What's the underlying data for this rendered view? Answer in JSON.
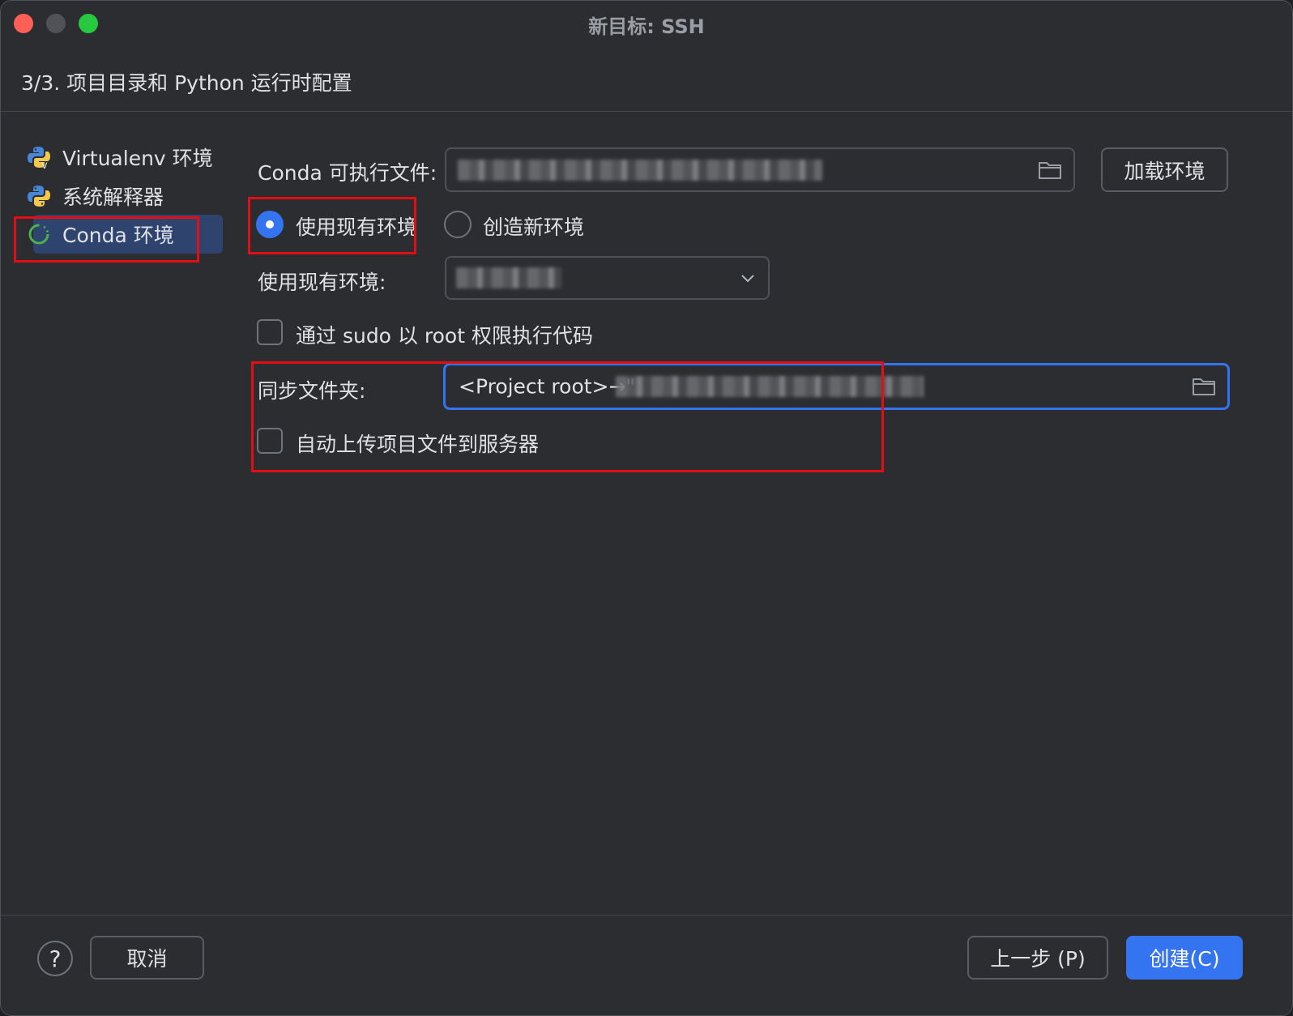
{
  "window": {
    "title": "新目标: SSH",
    "step_header": "3/3. 项目目录和 Python 运行时配置"
  },
  "sidebar": {
    "items": [
      {
        "label": "Virtualenv 环境",
        "icon": "virtualenv-python-icon",
        "selected": false
      },
      {
        "label": "系统解释器",
        "icon": "python-icon",
        "selected": false
      },
      {
        "label": "Conda 环境",
        "icon": "conda-icon",
        "selected": true
      }
    ]
  },
  "form": {
    "conda_executable_label": "Conda 可执行文件:",
    "load_env_button": "加载环境",
    "radio_existing": "使用现有环境",
    "radio_new": "创造新环境",
    "existing_env_label": "使用现有环境:",
    "sudo_checkbox": "通过 sudo 以 root 权限执行代码",
    "sync_folder_label": "同步文件夹:",
    "sync_folder_value": "<Project root>→\"",
    "auto_upload_checkbox": "自动上传项目文件到服务器"
  },
  "footer": {
    "help": "?",
    "cancel": "取消",
    "previous": "上一步 (P)",
    "create": "创建(C)"
  },
  "colors": {
    "accent": "#3574f0",
    "annotation": "#e30d14",
    "background": "#2b2d30"
  }
}
